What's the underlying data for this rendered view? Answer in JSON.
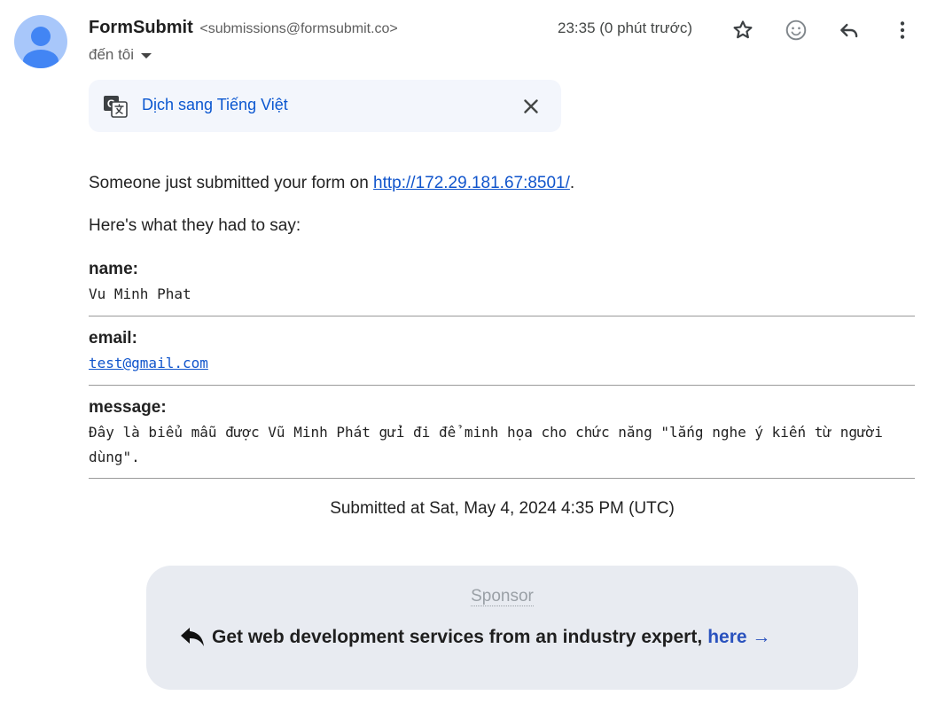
{
  "header": {
    "sender_name": "FormSubmit",
    "sender_email": "<submissions@formsubmit.co>",
    "to_label": "đến tôi",
    "time": "23:35 (0 phút trước)"
  },
  "translate": {
    "link": "Dịch sang Tiếng Việt"
  },
  "body": {
    "intro_prefix": "Someone just submitted your form on ",
    "intro_link": "http://172.29.181.67:8501/",
    "intro_suffix": ".",
    "lead": "Here's what they had to say:"
  },
  "fields": {
    "name_label": "name:",
    "name_value": "Vu Minh Phat",
    "email_label": "email:",
    "email_value": "test@gmail.com",
    "message_label": "message:",
    "message_value": "Đây là biểu mẫu được Vũ Minh Phát gửi đi để minh họa cho chức năng \"lắng nghe ý kiến từ người dùng\"."
  },
  "submitted": "Submitted at Sat, May 4, 2024 4:35 PM (UTC)",
  "sponsor": {
    "title": "Sponsor",
    "text": "Get web development services from an industry expert,",
    "link": "here →"
  },
  "icons": [
    "avatar-icon",
    "star-icon",
    "emoji-icon",
    "reply-icon",
    "more-icon",
    "translate-icon",
    "close-icon",
    "reply-arrow-icon"
  ]
}
